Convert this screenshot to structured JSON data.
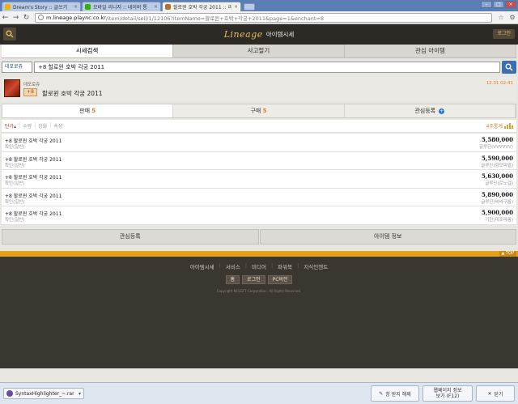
{
  "browser": {
    "tabs": [
      {
        "label": "Dream's Story :: 글쓰기",
        "active": false,
        "favicon_color": "#f0b400"
      },
      {
        "label": "모바일 리니지 :: 네이버 통",
        "active": false,
        "favicon_color": "#2db400"
      },
      {
        "label": "할로윈 호박 각궁 2011 :: 리",
        "active": true,
        "favicon_color": "#b0742a"
      }
    ],
    "url_domain": "m.lineage.plaync.co.kr",
    "url_path": "/item/detail/sell/1/12106?itemName=할로윈+호박+각궁+2011&page=1&enchant=8"
  },
  "header": {
    "logo_text": "Lineage",
    "subtitle": "아이템시세",
    "login_label": "로그인"
  },
  "main_tabs": [
    {
      "label": "시세검색",
      "active": true
    },
    {
      "label": "사고팔기",
      "active": false
    },
    {
      "label": "관심 아이템",
      "active": false
    }
  ],
  "search": {
    "server": "데포로쥬",
    "query": "+8 할로윈 호박 각궁 2011"
  },
  "item": {
    "server": "데포로쥬",
    "enchant": "+8",
    "name": "할로윈 호박 각궁 2011",
    "datetime": "12.31 02:41"
  },
  "trade_tabs": [
    {
      "label": "판매",
      "count": "5",
      "active": true
    },
    {
      "label": "구매",
      "count": "5",
      "active": false
    },
    {
      "label": "관심등록",
      "count": "",
      "active": false
    }
  ],
  "sort": {
    "options": [
      "단가",
      "수량",
      "강화",
      "속성"
    ],
    "active_option": "단가",
    "trend_label": "4주통계"
  },
  "listings": [
    {
      "name": "+8 할로윈 호박 각궁 2011",
      "status": "확인(일반)",
      "price": "5,580,000",
      "seller": "글루딘(VVVVVV)"
    },
    {
      "name": "+8 할로윈 호박 각궁 2011",
      "status": "확인(일반)",
      "price": "5,590,000",
      "seller": "글루딘(항모퍼벌)"
    },
    {
      "name": "+8 할로윈 호박 각궁 2011",
      "status": "확인(일반)",
      "price": "5,630,000",
      "seller": "글루딘(로노걸)"
    },
    {
      "name": "+8 할로윈 호박 각궁 2011",
      "status": "확인(일반)",
      "price": "5,890,000",
      "seller": "글루딘(바바구름)"
    },
    {
      "name": "+8 할로윈 호박 각궁 2011",
      "status": "확인(일반)",
      "price": "5,900,000",
      "seller": "기란(데포파룸)"
    }
  ],
  "bottom_buttons": [
    "관심등록",
    "아이템 정보"
  ],
  "top_label": "TOP",
  "footer": {
    "links": [
      "아이템시세",
      "서비스",
      "미디어",
      "파워북",
      "지식인헨트"
    ],
    "buttons": [
      "홈",
      "로그인",
      "PC버전"
    ],
    "copyright": "Copyright NCSOFT Corporation. All Rights Reserved."
  },
  "downloads": {
    "file": "SyntaxHighlighter_~.rar",
    "popup_a": "창 받지 해제",
    "popup_b_line1": "웹페이지 정보",
    "popup_b_line2": "보기 (F12)",
    "popup_c": "닫기"
  }
}
